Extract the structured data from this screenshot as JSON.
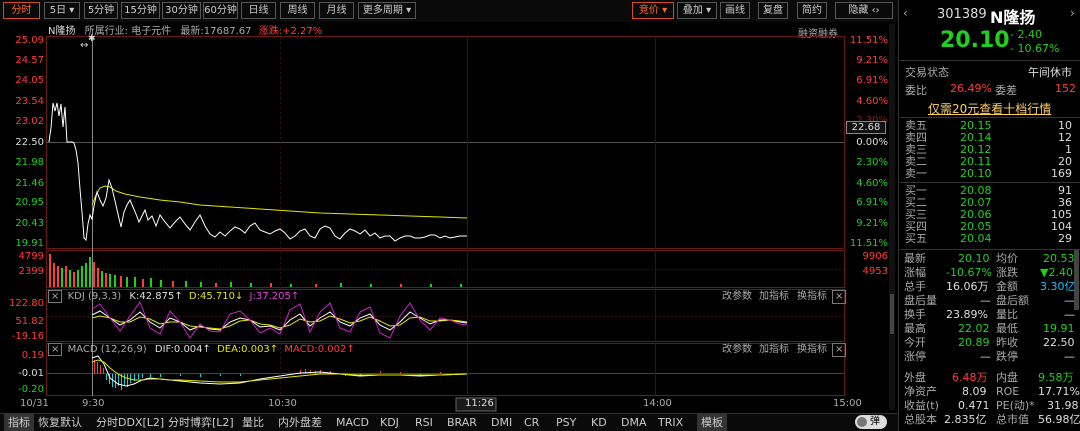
{
  "toolbar": {
    "periods": [
      "分时",
      "5日",
      "5分钟",
      "15分钟",
      "30分钟",
      "60分钟",
      "日线",
      "周线",
      "月线",
      "更多周期"
    ],
    "right_buttons": [
      "竞价",
      "叠加",
      "画线",
      "复盘",
      "简约",
      "隐藏"
    ]
  },
  "chart": {
    "header_name": "N隆扬",
    "header_industry": "所属行业: 电子元件",
    "header_latest": "最新:17687.67",
    "header_change": "涨跌:+2.27%",
    "margin_label": "融资融券",
    "price_axis": [
      "25.09",
      "24.57",
      "24.05",
      "23.54",
      "23.02",
      "22.50",
      "21.98",
      "21.46",
      "20.95",
      "20.43",
      "19.91"
    ],
    "pct_axis": [
      "11.51%",
      "9.21%",
      "6.91%",
      "4.60%",
      "2.30%",
      "0.00%",
      "2.30%",
      "4.60%",
      "6.91%",
      "9.21%",
      "11.51%"
    ],
    "pct_hidden": "2.30%",
    "current_price_tag": "22.68",
    "volume_left": [
      "4799",
      "2399"
    ],
    "volume_right": [
      "9906",
      "4953"
    ],
    "time_labels": [
      "10/31",
      "9:30",
      "10:30",
      "11:26",
      "14:00",
      "15:00"
    ],
    "crosshair_arrow": "↔"
  },
  "kdj": {
    "title_prefix": "KDJ (9,3,3)",
    "k_value": "K:42.875↑",
    "d_value": "D:45.710↓",
    "j_value": "J:37.205↑",
    "axis": [
      "122.80",
      "51.82",
      "-19.16"
    ],
    "buttons": [
      "改参数",
      "加指标",
      "换指标"
    ]
  },
  "macd": {
    "title_prefix": "MACD (12,26,9)",
    "dif_value": "DIF:0.004↑",
    "dea_value": "DEA:0.003↑",
    "macd_value": "MACD:0.002↑",
    "axis": [
      "0.19",
      "-0.01",
      "-0.20"
    ],
    "buttons": [
      "改参数",
      "加指标",
      "换指标"
    ]
  },
  "bottom_tabs": [
    "指标",
    "恢复默认",
    "分时DDX[L2]",
    "分时博弈[L2]",
    "量比",
    "内外盘差",
    "MACD",
    "KDJ",
    "RSI",
    "BRAR",
    "DMI",
    "CR",
    "PSY",
    "KD",
    "DMA",
    "TRIX",
    "模板"
  ],
  "bottom_toggle": "弹",
  "quote": {
    "code": "301389",
    "name": "N隆扬",
    "price": "20.10",
    "change": "- 2.40",
    "change_pct": "- 10.67%",
    "status_label": "交易状态",
    "status_value": "午间休市",
    "wb_label": "委比",
    "wb_value": "26.49%",
    "wc_label": "委差",
    "wc_value": "152",
    "promo": "仅需20元查看十档行情",
    "asks": [
      {
        "label": "卖五",
        "price": "20.15",
        "vol": "10"
      },
      {
        "label": "卖四",
        "price": "20.14",
        "vol": "12"
      },
      {
        "label": "卖三",
        "price": "20.12",
        "vol": "1"
      },
      {
        "label": "卖二",
        "price": "20.11",
        "vol": "20"
      },
      {
        "label": "卖一",
        "price": "20.10",
        "vol": "169"
      }
    ],
    "bids": [
      {
        "label": "买一",
        "price": "20.08",
        "vol": "91"
      },
      {
        "label": "买二",
        "price": "20.07",
        "vol": "36"
      },
      {
        "label": "买三",
        "price": "20.06",
        "vol": "105"
      },
      {
        "label": "买四",
        "price": "20.05",
        "vol": "104"
      },
      {
        "label": "买五",
        "price": "20.04",
        "vol": "29"
      }
    ],
    "stats": [
      [
        "最新",
        "20.10",
        "均价",
        "20.53"
      ],
      [
        "涨幅",
        "-10.67%",
        "涨跌",
        "▼2.40"
      ],
      [
        "总手",
        "16.06万",
        "金额",
        "3.30亿"
      ],
      [
        "盘后量",
        "—",
        "盘后额",
        "—"
      ],
      [
        "换手",
        "23.89%",
        "量比",
        "—"
      ],
      [
        "最高",
        "22.02",
        "最低",
        "19.91"
      ],
      [
        "今开",
        "20.89",
        "昨收",
        "22.50"
      ],
      [
        "涨停",
        "—",
        "跌停",
        "—"
      ],
      [
        "外盘",
        "6.48万",
        "内盘",
        "9.58万"
      ],
      [
        "净资产",
        "8.09",
        "ROE",
        "17.71%"
      ],
      [
        "收益(t)",
        "0.471",
        "PE(动)*",
        "31.98"
      ],
      [
        "总股本",
        "2.835亿",
        "总市值",
        "56.98亿"
      ]
    ]
  },
  "colors": {
    "up": "#ff3c3c",
    "down": "#20d020",
    "avg_line": "#e6e600",
    "price_line": "#ffffff",
    "accent": "#ff6a2a"
  }
}
